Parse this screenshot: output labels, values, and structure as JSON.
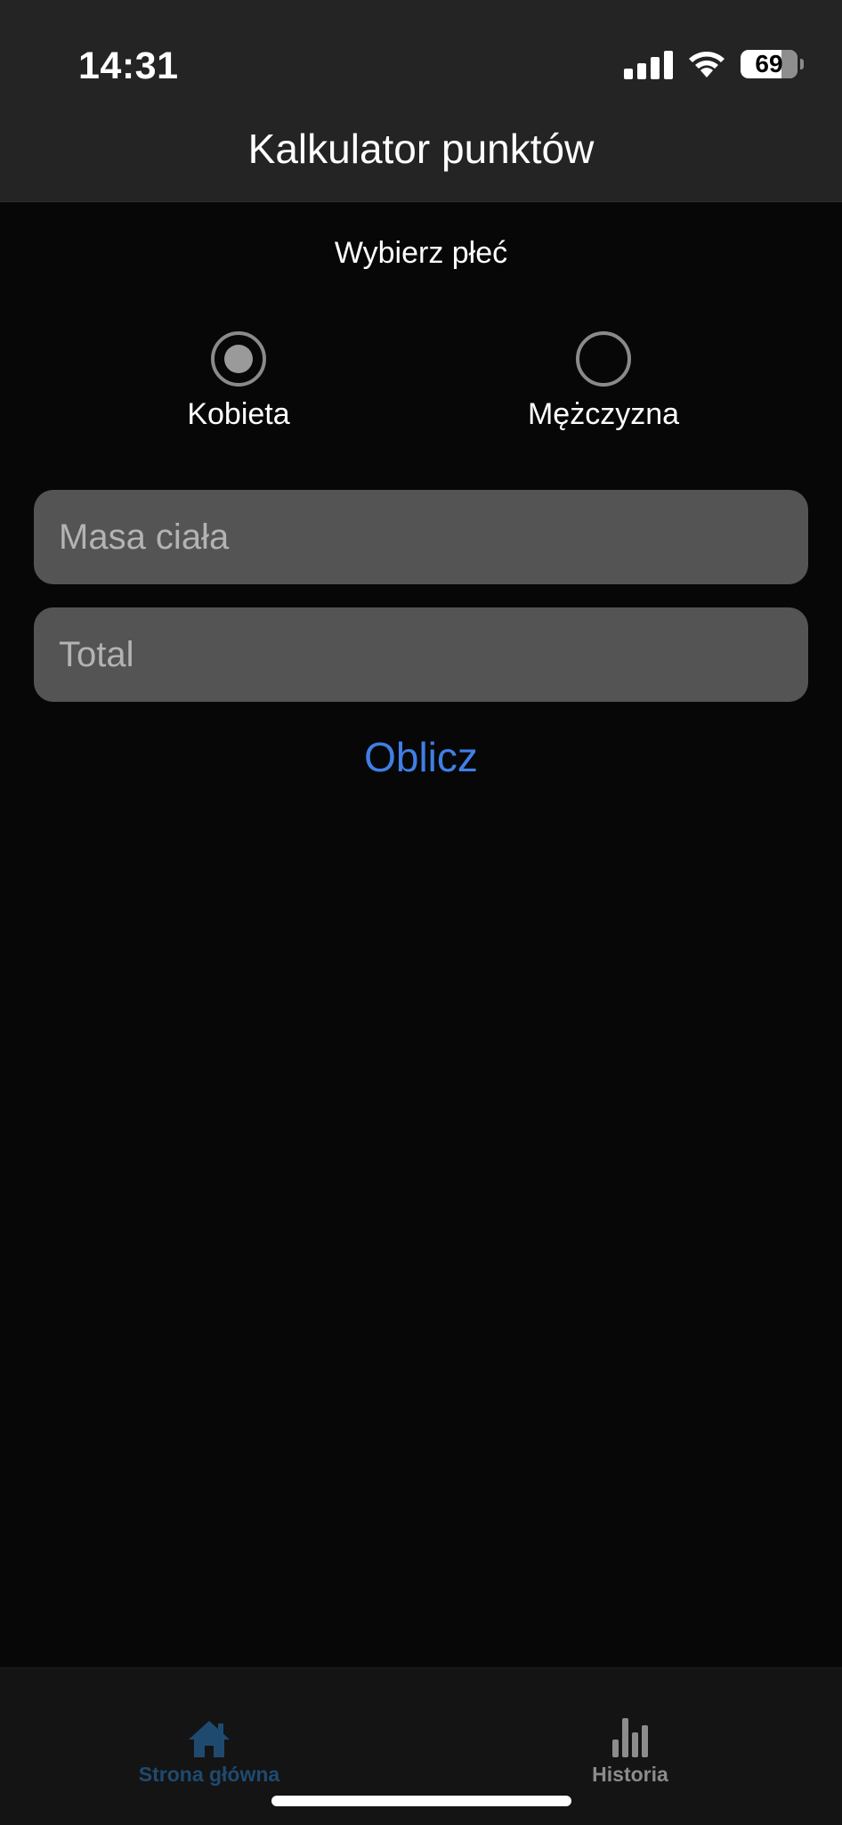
{
  "status_bar": {
    "time": "14:31",
    "battery": "69",
    "icons": [
      "signal-icon",
      "wifi-icon",
      "battery-icon"
    ]
  },
  "nav": {
    "title": "Kalkulator punktów"
  },
  "gender": {
    "label": "Wybierz płeć",
    "options": [
      {
        "label": "Kobieta",
        "selected": true
      },
      {
        "label": "Mężczyzna",
        "selected": false
      }
    ]
  },
  "form": {
    "body_mass_placeholder": "Masa ciała",
    "total_placeholder": "Total",
    "calculate_label": "Oblicz"
  },
  "tabbar": {
    "tabs": [
      {
        "label": "Strona główna",
        "icon": "home-icon",
        "active": true
      },
      {
        "label": "Historia",
        "icon": "bar-chart-icon",
        "active": false
      }
    ]
  },
  "colors": {
    "accent": "#3f7fe6",
    "active_tab": "#1f4a70",
    "inactive_tab": "#8c8c8c",
    "field_bg": "#545454",
    "header_bg": "#242424",
    "background": "#070707"
  }
}
